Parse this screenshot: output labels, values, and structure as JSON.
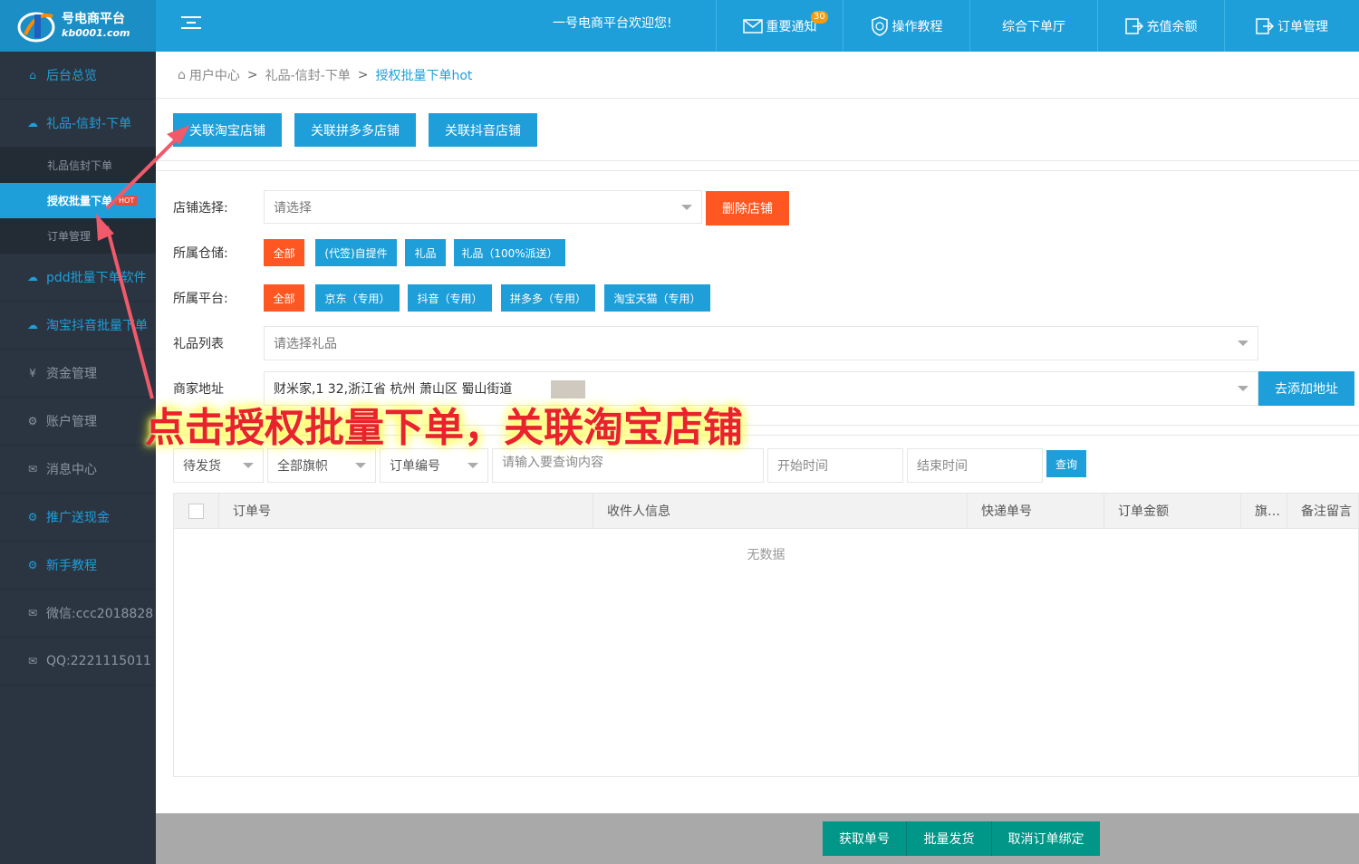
{
  "header": {
    "logo_name": "号电商平台",
    "logo_url": "kb0001.com",
    "welcome": "一号电商平台欢迎您!",
    "nav": [
      {
        "label": "重要通知",
        "badge": "30"
      },
      {
        "label": "操作教程"
      },
      {
        "label": "综合下单厅"
      },
      {
        "label": "充值余额"
      },
      {
        "label": "订单管理"
      }
    ]
  },
  "sidebar": {
    "items": [
      {
        "label": "后台总览"
      },
      {
        "label": "礼品-信封-下单"
      },
      {
        "label": "礼品信封下单"
      },
      {
        "label": "授权批量下单",
        "badge": "HOT"
      },
      {
        "label": "订单管理"
      },
      {
        "label": "pdd批量下单软件"
      },
      {
        "label": "淘宝抖音批量下单"
      },
      {
        "label": "资金管理"
      },
      {
        "label": "账户管理"
      },
      {
        "label": "消息中心"
      },
      {
        "label": "推广送现金"
      },
      {
        "label": "新手教程"
      },
      {
        "label": "微信:ccc2018828"
      },
      {
        "label": "QQ:2221115011"
      }
    ]
  },
  "breadcrumb": {
    "home": "用户中心",
    "level1": "礼品-信封-下单",
    "current": "授权批量下单hot"
  },
  "shop_buttons": {
    "taobao": "关联淘宝店铺",
    "pdd": "关联拼多多店铺",
    "douyin": "关联抖音店铺"
  },
  "form": {
    "shop_label": "店铺选择:",
    "shop_placeholder": "请选择",
    "delete_shop": "删除店铺",
    "warehouse_label": "所属仓储:",
    "warehouse_tags": [
      "全部",
      "(代签)自提件",
      "礼品",
      "礼品（100%派送）"
    ],
    "platform_label": "所属平台:",
    "platform_tags": [
      "全部",
      "京东（专用）",
      "抖音（专用）",
      "拼多多（专用）",
      "淘宝天猫（专用）"
    ],
    "gift_label": "礼品列表",
    "gift_placeholder": "请选择礼品",
    "address_label": "商家地址",
    "address_value": "财米家,1      32,浙江省 杭州 萧山区 蜀山街道",
    "add_address": "去添加地址"
  },
  "filters": {
    "status": "待发货",
    "flag": "全部旗帜",
    "field": "订单编号",
    "query_placeholder": "请输入要查询内容",
    "start_placeholder": "开始时间",
    "end_placeholder": "结束时间",
    "search": "查询"
  },
  "table": {
    "columns": [
      "订单号",
      "收件人信息",
      "快递单号",
      "订单金额",
      "旗…",
      "备注留言"
    ],
    "empty": "无数据"
  },
  "footer": {
    "get_numbers": "获取单号",
    "batch_ship": "批量发货",
    "unbind": "取消订单绑定"
  },
  "annotation": "点击授权批量下单，关联淘宝店铺",
  "colors": {
    "primary": "#1e9fda",
    "orange": "#ff5722",
    "teal": "#009688",
    "sidebar": "#2b3541"
  }
}
